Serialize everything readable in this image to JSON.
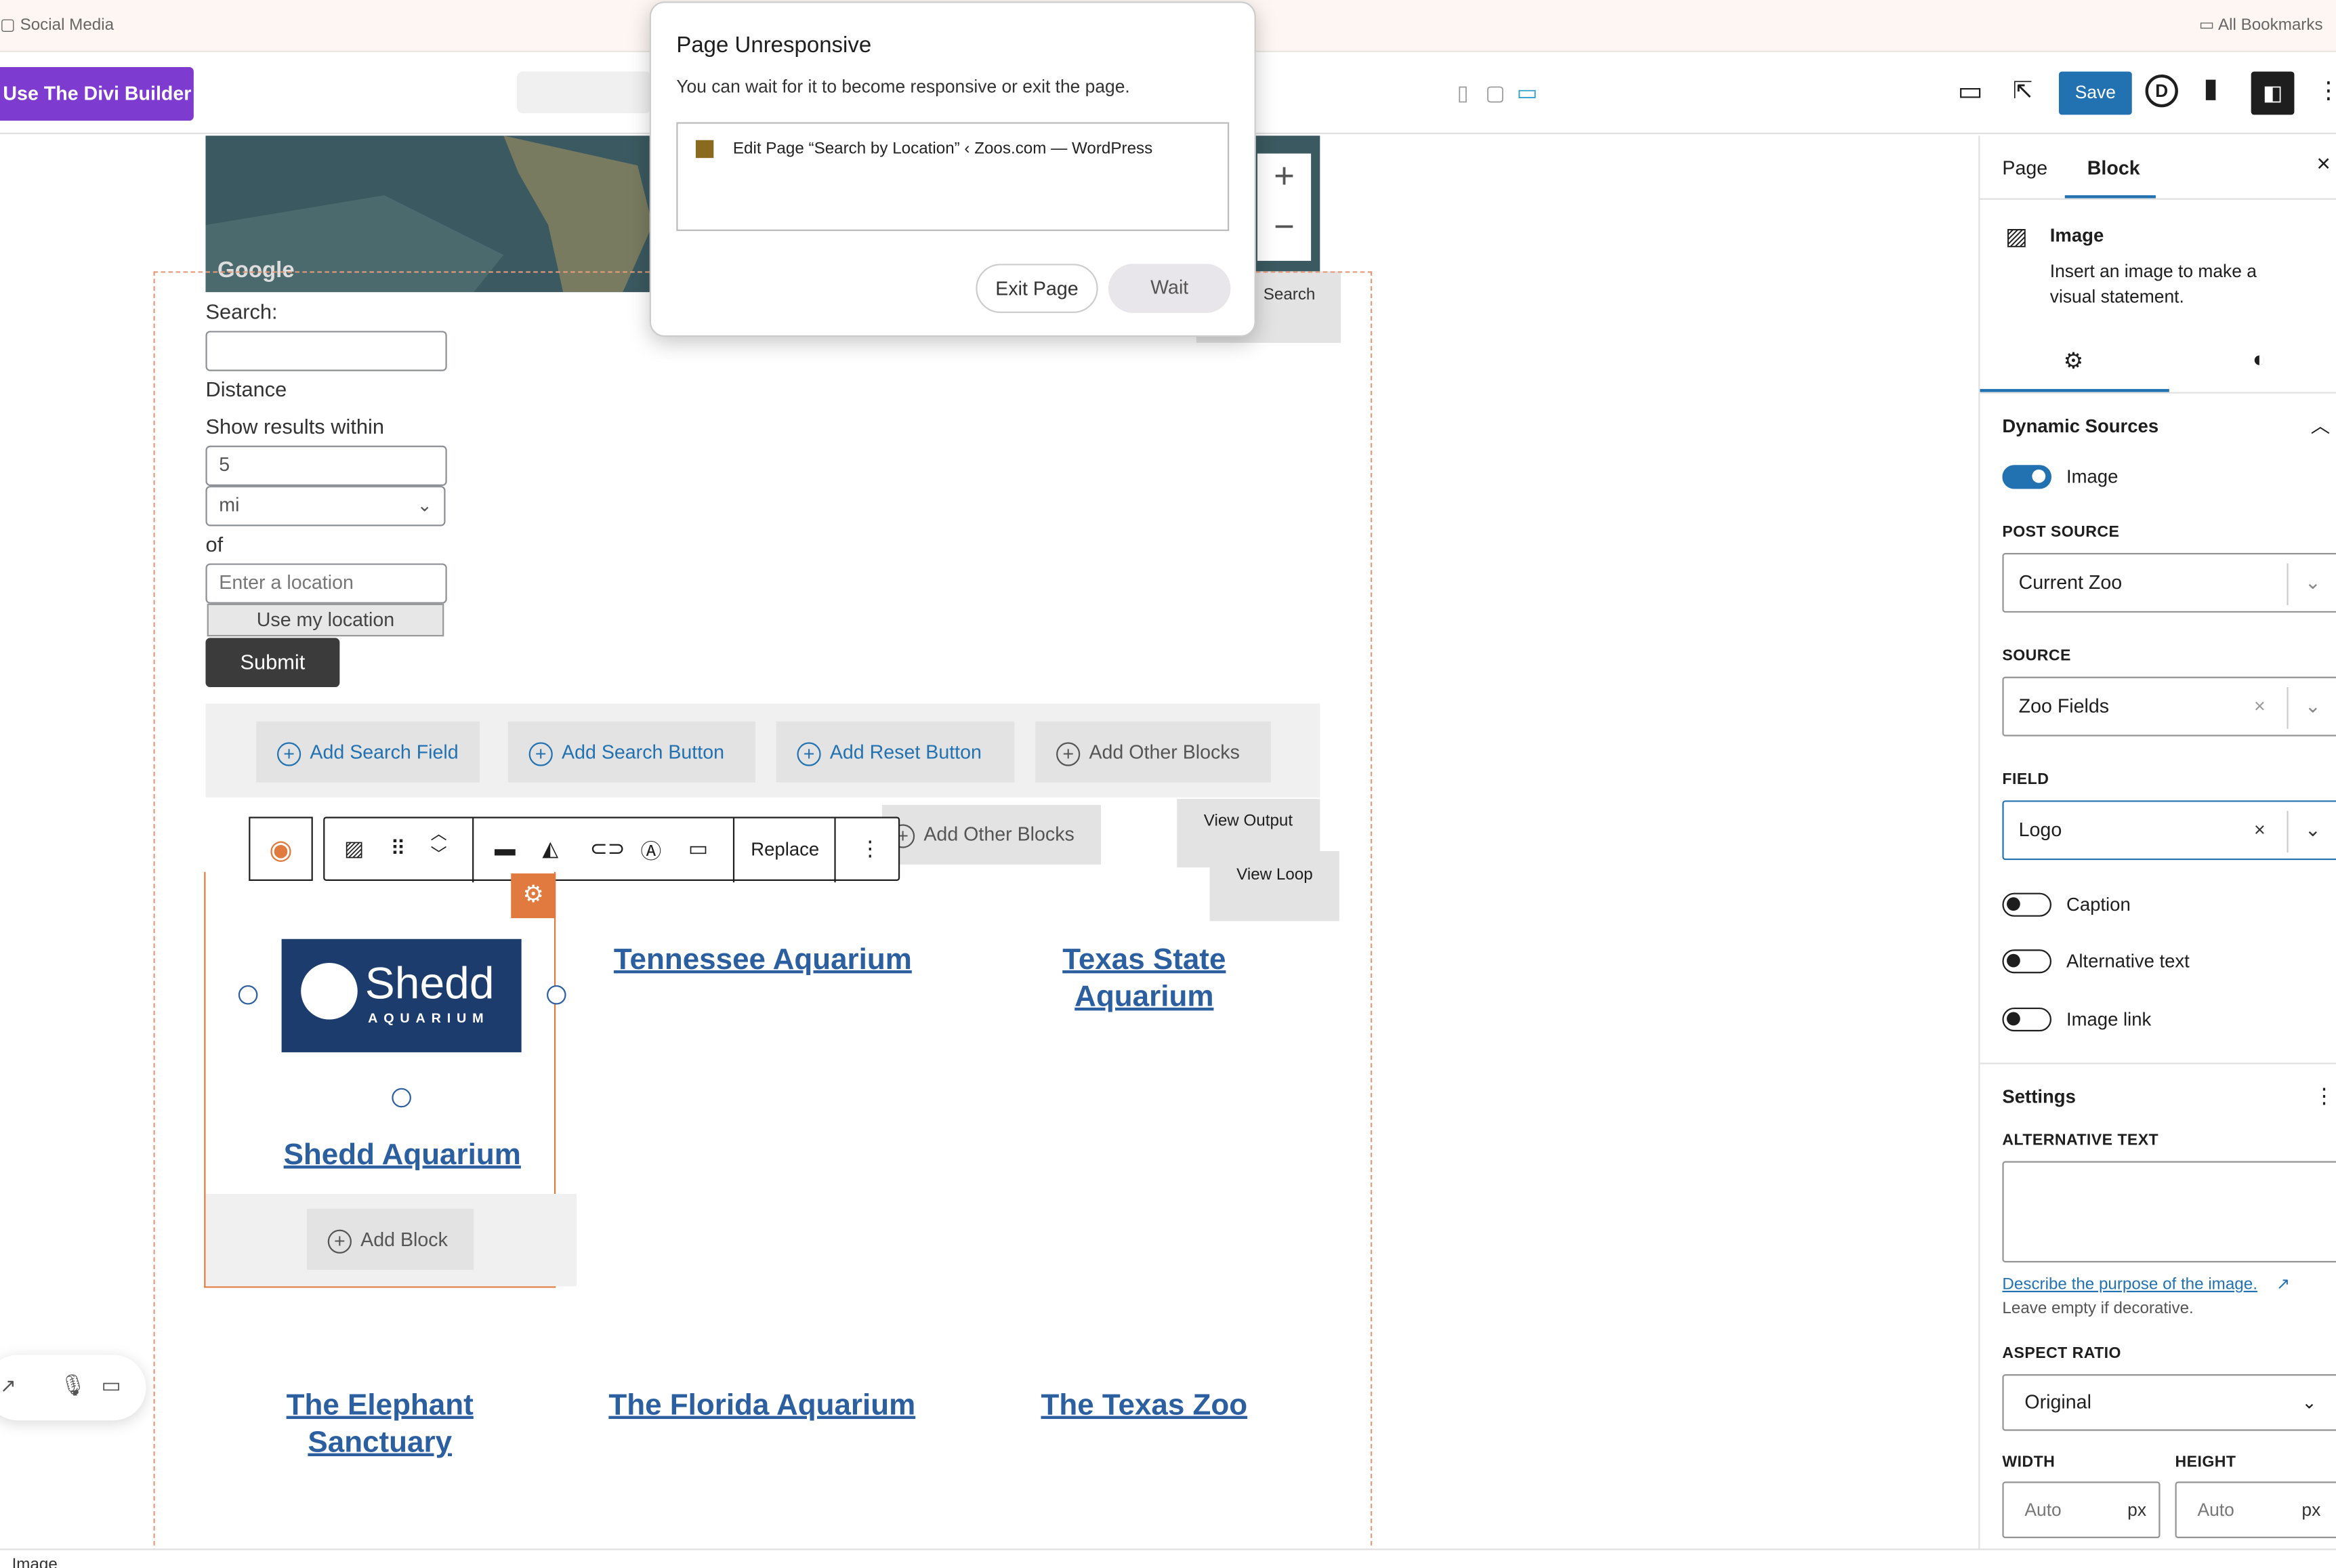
{
  "bookmarks": {
    "left": "Social Media",
    "right": "All Bookmarks"
  },
  "toolbar": {
    "divi_label": "Use The Divi Builder",
    "save_label": "Save"
  },
  "map": {
    "logo": "Google",
    "search_label": "Search"
  },
  "form": {
    "search_label": "Search:",
    "distance_label": "Distance",
    "within_label": "Show results within",
    "distance_value": "5",
    "unit_value": "mi",
    "of_label": "of",
    "location_placeholder": "Enter a location",
    "use_location": "Use my location",
    "submit": "Submit"
  },
  "add_bar": {
    "search_field": "Add Search Field",
    "search_button": "Add Search Button",
    "reset_button": "Add Reset Button",
    "other_blocks": "Add Other Blocks"
  },
  "second_bar": {
    "other_blocks": "Add Other Blocks",
    "view_output": "View Output",
    "view_loop": "View Loop"
  },
  "block_toolbar": {
    "replace": "Replace"
  },
  "shedd_logo": {
    "name": "Shedd",
    "sub": "AQUARIUM"
  },
  "results": {
    "shedd": "Shedd Aquarium",
    "tennessee": "Tennessee Aquarium",
    "texas_state": "Texas State Aquarium",
    "elephant": "The Elephant Sanctuary",
    "florida": "The Florida Aquarium",
    "texas_zoo": "The Texas Zoo",
    "add_block": "Add Block"
  },
  "sidebar": {
    "tab_page": "Page",
    "tab_block": "Block",
    "block_name": "Image",
    "block_desc": "Insert an image to make a visual statement.",
    "dynamic_sources": "Dynamic Sources",
    "image_toggle": "Image",
    "post_source_label": "POST SOURCE",
    "post_source_value": "Current Zoo",
    "source_label": "SOURCE",
    "source_value": "Zoo Fields",
    "field_label": "FIELD",
    "field_value": "Logo",
    "caption": "Caption",
    "alt_text_toggle": "Alternative text",
    "image_link": "Image link",
    "settings": "Settings",
    "alt_text_label": "ALTERNATIVE TEXT",
    "alt_help_link": "Describe the purpose of the image.",
    "alt_help": "Leave empty if decorative.",
    "aspect_label": "ASPECT RATIO",
    "aspect_value": "Original",
    "width_label": "WIDTH",
    "height_label": "HEIGHT",
    "width_placeholder": "Auto",
    "height_placeholder": "Auto",
    "unit": "px"
  },
  "modal": {
    "title": "Page Unresponsive",
    "message": "You can wait for it to become responsive or exit the page.",
    "page_title": "Edit Page “Search by Location” ‹ Zoos.com — WordPress",
    "exit": "Exit Page",
    "wait": "Wait"
  },
  "status": {
    "breadcrumb": "Image"
  },
  "colors": {
    "accent": "#2271b1",
    "divi": "#7e3bd0",
    "highlight": "#e07a3f",
    "link": "#2b5fa0"
  }
}
